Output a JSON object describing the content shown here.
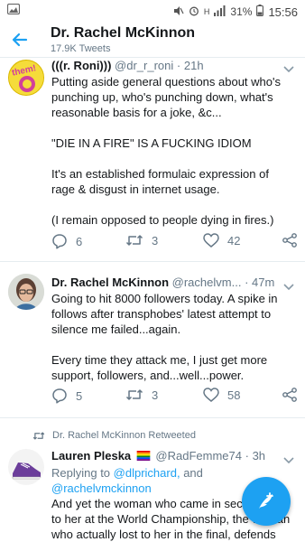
{
  "status_bar": {
    "battery": "31%",
    "time": "15:56",
    "network": "H"
  },
  "header": {
    "title": "Dr. Rachel McKinnon",
    "subtitle": "17.9K Tweets"
  },
  "tweets": [
    {
      "name": "(((r. Roni)))",
      "handle": "@dr_r_roni",
      "time": "21h",
      "paragraphs": [
        "Putting aside general questions about who's punching up, who's punching down, what's reasonable basis for a joke, &c...",
        "\"DIE IN A FIRE\" IS A FUCKING IDIOM",
        "It's an established formulaic expression of rage & disgust in internet usage.",
        "(I remain opposed to people dying in fires.)"
      ],
      "replies": "6",
      "retweets": "3",
      "likes": "42",
      "avatar_text": "them!"
    },
    {
      "name": "Dr. Rachel McKinnon",
      "handle": "@rachelvm...",
      "time": "47m",
      "paragraphs": [
        "Going to hit 8000 followers today. A spike in follows after transphobes' latest attempt to silence me failed...again.",
        "Every time they attack me, I just get more support, followers, and...well...power."
      ],
      "replies": "5",
      "retweets": "3",
      "likes": "58"
    },
    {
      "retweeted_by": "Dr. Rachel McKinnon Retweeted",
      "name": "Lauren Pleska",
      "handle": "@RadFemme74",
      "time": "3h",
      "replying_prefix": "Replying to ",
      "replying_users": [
        "@dlprichard,",
        "and",
        "@rachelvmckinnon"
      ],
      "body_lines": [
        "And yet the woman who came in sec",
        "to her at the World Championship, the",
        "who actually lost to her in the final, defends"
      ],
      "body_line_tails": [
        "ond",
        "",
        ""
      ],
      "body_line_mid": [
        "",
        "woman",
        ""
      ]
    }
  ],
  "colors": {
    "accent": "#1da1f2",
    "text": "#14171a",
    "secondary": "#657786",
    "divider": "#e6ecf0"
  },
  "icons": [
    "back-arrow-icon",
    "reply-icon",
    "retweet-icon",
    "like-icon",
    "share-icon",
    "compose-icon",
    "caret-down-icon"
  ]
}
